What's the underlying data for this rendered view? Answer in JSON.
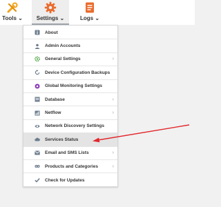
{
  "nav": {
    "tools_label": "Tools",
    "settings_label": "Settings",
    "logs_label": "Logs"
  },
  "menu": {
    "items": [
      {
        "label": "About",
        "icon": "info-icon",
        "submenu": false
      },
      {
        "label": "Admin Accounts",
        "icon": "user-icon",
        "submenu": false
      },
      {
        "label": "General Settings",
        "icon": "gear-icon",
        "submenu": true
      },
      {
        "label": "Device Configuration Backups",
        "icon": "backup-icon",
        "submenu": false
      },
      {
        "label": "Global Monitoring Settings",
        "icon": "monitor-icon",
        "submenu": false
      },
      {
        "label": "Database",
        "icon": "database-icon",
        "submenu": true
      },
      {
        "label": "Netflow",
        "icon": "netflow-icon",
        "submenu": true
      },
      {
        "label": "Network Discovery Settings",
        "icon": "eye-icon",
        "submenu": false
      },
      {
        "label": "Services Status",
        "icon": "cloud-icon",
        "submenu": false
      },
      {
        "label": "Email and SMS Lists",
        "icon": "envelope-icon",
        "submenu": true
      },
      {
        "label": "Products and Categories",
        "icon": "products-icon",
        "submenu": true
      },
      {
        "label": "Check for Updates",
        "icon": "check-icon",
        "submenu": false
      }
    ],
    "highlighted_item": "Services Status"
  },
  "colors": {
    "arrow": "#e3262b",
    "tools_icon": "#f2a31b",
    "settings_icon": "#e96c2e",
    "logs_icon": "#e96c2e"
  }
}
